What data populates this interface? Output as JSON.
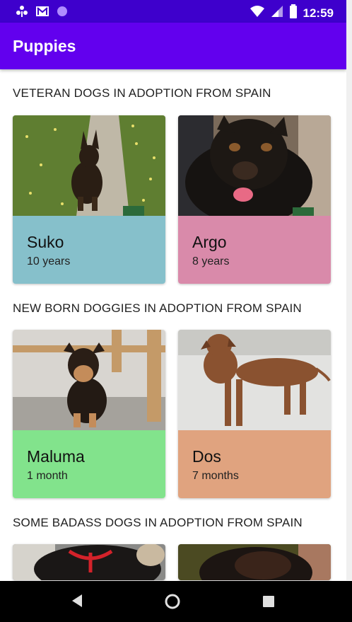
{
  "status_bar": {
    "time": "12:59",
    "icons": [
      "wind-icon",
      "gmail-icon",
      "dot-icon",
      "wifi-icon",
      "signal-icon",
      "battery-icon"
    ],
    "background": "#3e00cc"
  },
  "app_bar": {
    "title": "Puppies",
    "background": "#6200ee"
  },
  "sections": [
    {
      "title": "VETERAN DOGS IN ADOPTION FROM SPAIN",
      "dogs": [
        {
          "name": "Suko",
          "age": "10 years",
          "color": "#86c0cb"
        },
        {
          "name": "Argo",
          "age": "8 years",
          "color": "#d98aaa"
        }
      ]
    },
    {
      "title": "NEW BORN DOGGIES IN ADOPTION FROM SPAIN",
      "dogs": [
        {
          "name": "Maluma",
          "age": "1 month",
          "color": "#82e38c"
        },
        {
          "name": "Dos",
          "age": "7 months",
          "color": "#e0a37f"
        }
      ]
    },
    {
      "title": "SOME BADASS DOGS IN ADOPTION FROM SPAIN",
      "dogs": []
    }
  ],
  "nav_bar": {
    "icons": [
      "back-icon",
      "home-icon",
      "recents-icon"
    ]
  }
}
